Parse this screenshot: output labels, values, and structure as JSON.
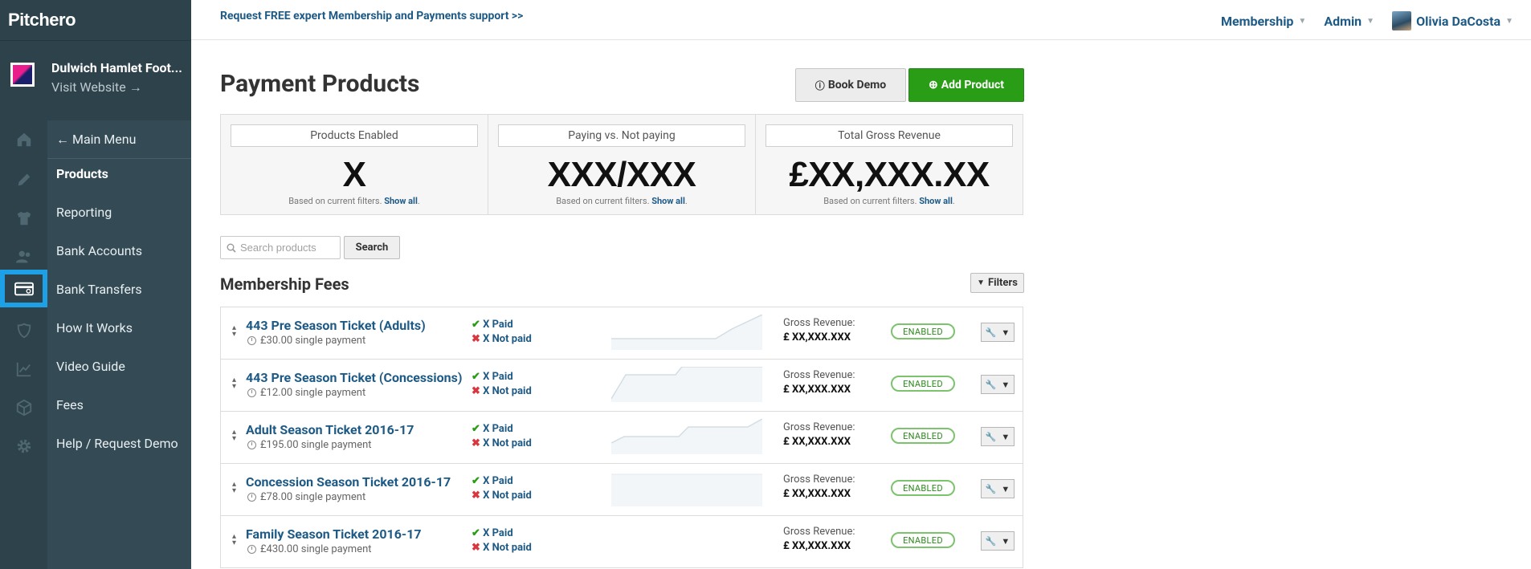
{
  "brand": {
    "logo_text": "Pitchero"
  },
  "club": {
    "name": "Dulwich Hamlet Foot...",
    "visit_label": "Visit Website →"
  },
  "rail_icons": [
    "home-icon",
    "pencil-icon",
    "shirt-icon",
    "users-icon",
    "credit-card-icon",
    "shield-icon",
    "chart-icon",
    "box-icon",
    "gear-icon"
  ],
  "nav": {
    "back_label": "← Main Menu",
    "items": [
      {
        "label": "Products",
        "active": true
      },
      {
        "label": "Reporting"
      },
      {
        "label": "Bank Accounts"
      },
      {
        "label": "Bank Transfers"
      },
      {
        "label": "How It Works"
      },
      {
        "label": "Video Guide"
      },
      {
        "label": "Fees"
      },
      {
        "label": "Help / Request Demo"
      }
    ]
  },
  "topbar": {
    "promo": "Request FREE expert Membership and Payments support >>",
    "membership": "Membership",
    "admin": "Admin",
    "user": "Olivia DaCosta"
  },
  "page": {
    "title": "Payment Products",
    "book_demo": "Book Demo",
    "add_product": "Add Product"
  },
  "stats": [
    {
      "label": "Products Enabled",
      "value": "X",
      "sub": "Based on current filters.",
      "link": "Show all"
    },
    {
      "label": "Paying vs. Not paying",
      "value": "XXX/XXX",
      "sub": "Based on current filters.",
      "link": "Show all"
    },
    {
      "label": "Total Gross Revenue",
      "value": "£XX,XXX.XX",
      "sub": "Based on current filters.",
      "link": "Show all"
    }
  ],
  "search": {
    "placeholder": "Search products",
    "button": "Search"
  },
  "section": {
    "title": "Membership Fees",
    "filters": "Filters"
  },
  "products": [
    {
      "name": "443 Pre Season Ticket (Adults)",
      "price": "£30.00 single payment",
      "paid": "X Paid",
      "not_paid": "X Not paid",
      "gross_label": "Gross Revenue:",
      "gross": "£ XX,XXX.XXX",
      "status": "ENABLED"
    },
    {
      "name": "443 Pre Season Ticket (Concessions)",
      "price": "£12.00 single payment",
      "paid": "X Paid",
      "not_paid": "X Not paid",
      "gross_label": "Gross Revenue:",
      "gross": "£ XX,XXX.XXX",
      "status": "ENABLED"
    },
    {
      "name": "Adult Season Ticket 2016-17",
      "price": "£195.00 single payment",
      "paid": "X Paid",
      "not_paid": "X Not paid",
      "gross_label": "Gross Revenue:",
      "gross": "£ XX,XXX.XXX",
      "status": "ENABLED"
    },
    {
      "name": "Concession Season Ticket 2016-17",
      "price": "£78.00 single payment",
      "paid": "X Paid",
      "not_paid": "X Not paid",
      "gross_label": "Gross Revenue:",
      "gross": "£ XX,XXX.XXX",
      "status": "ENABLED"
    },
    {
      "name": "Family Season Ticket 2016-17",
      "price": "£430.00 single payment",
      "paid": "X Paid",
      "not_paid": "X Not paid",
      "gross_label": "Gross Revenue:",
      "gross": "£ XX,XXX.XXX",
      "status": "ENABLED"
    }
  ],
  "colors": {
    "sidebar": "#2e424c",
    "nav_panel": "#344b56",
    "link": "#1e5a86",
    "add_button": "#2a9d16",
    "active_highlight": "#1ea0e6"
  }
}
